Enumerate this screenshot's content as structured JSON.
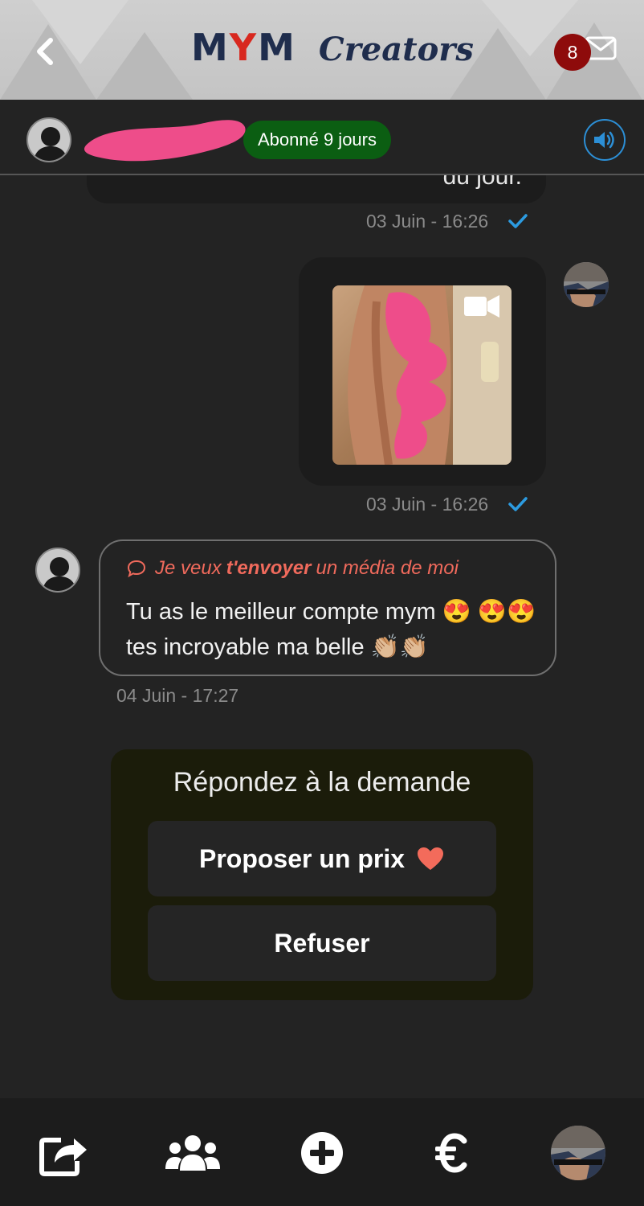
{
  "header": {
    "back_icon": "chevron-left-icon",
    "logo_mym_m1": "M",
    "logo_mym_y": "Y",
    "logo_mym_m2": "M",
    "logo_creators": "Creators",
    "unread_count": "8",
    "messages_icon": "envelope-icon"
  },
  "contact": {
    "subscription_badge": "Abonné 9 jours",
    "sound_icon": "volume-icon"
  },
  "messages": {
    "previous_text_fragment": "du jour.",
    "outgoing_1_time": "03 Juin - 16:26",
    "outgoing_2_time": "03 Juin - 16:26",
    "media_type_icon": "video-camera-icon",
    "incoming": {
      "request_prefix": "Je veux",
      "request_bold": "t'envoyer",
      "request_suffix": "un média de moi",
      "text": "Tu as le meilleur compte mym 😍 😍😍tes incroyable ma belle 👏🏼👏🏼",
      "time": "04 Juin - 17:27"
    }
  },
  "response": {
    "title": "Répondez à la demande",
    "propose_label": "Proposer un prix",
    "refuse_label": "Refuser"
  },
  "nav": {
    "share_icon": "share-icon",
    "fans_icon": "users-icon",
    "add_icon": "plus-circle-icon",
    "euro_icon": "euro-icon",
    "profile_icon": "profile-avatar"
  },
  "colors": {
    "header_bg": "#c8c8c8",
    "logo_navy": "#1f2d4d",
    "logo_red": "#d8281f",
    "badge_red": "#8e0b0b",
    "subscription_green": "#0b5e12",
    "check_blue": "#2c9be0",
    "request_coral": "#f06a5c",
    "app_bg": "#232323",
    "redaction_pink": "#ee4d8a"
  }
}
